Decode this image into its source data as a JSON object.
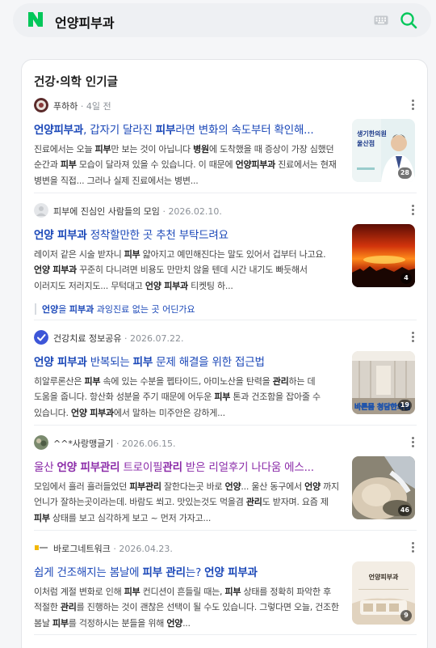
{
  "search": {
    "query": "언양피부과"
  },
  "section": {
    "title": "건강·의학 인기글"
  },
  "posts": [
    {
      "author": "푸하하",
      "date": "4일 전",
      "title_parts": [
        [
          "언양피부과",
          true
        ],
        [
          ", 갑자기 달라진 ",
          false
        ],
        [
          "피부",
          true
        ],
        [
          "라면 변화의 속도부터 확인해...",
          false
        ]
      ],
      "body_parts": [
        [
          "진료에서는 오늘 ",
          false
        ],
        [
          "피부",
          true
        ],
        [
          "만 보는 것이 아닙니다 ",
          false
        ],
        [
          "병원",
          true
        ],
        [
          "에 도착했을 때 증상이 가장 심했던 순간과 ",
          false
        ],
        [
          "피부",
          true
        ],
        [
          " 모습이 달라져 있을 수 있습니다. 이 때문에 ",
          false
        ],
        [
          "언양피부과",
          true
        ],
        [
          " 진료에서는 현재 병변을 직접... 그러나 실제 진료에서는 병변...",
          false
        ]
      ],
      "thumb_count": "28"
    },
    {
      "author": "피부에 진심인 사람들의 모임",
      "date": "2026.02.10.",
      "title_parts": [
        [
          "언양 피부과",
          true
        ],
        [
          " 정착할만한 곳 추천 부탁드려요",
          false
        ]
      ],
      "body_parts": [
        [
          "레이저 같은 시술 받자니 ",
          false
        ],
        [
          "피부",
          true
        ],
        [
          " 얇아지고 예민해진다는 말도 있어서 겁부터 나고요. ",
          false
        ],
        [
          "언양 피부과",
          true
        ],
        [
          " 꾸준히 다니려면 비용도 만만치 않을 텐데 시간 내기도 빠듯해서 이러지도 저러지도... 무턱대고 ",
          false
        ],
        [
          "언양 피부과",
          true
        ],
        [
          " 티켓팅 하...",
          false
        ]
      ],
      "thumb_count": "4",
      "related": [
        [
          "언양",
          true
        ],
        [
          "을 ",
          false
        ],
        [
          "피부과",
          true
        ],
        [
          " 과잉진료 없는 곳 어딘가요",
          false
        ]
      ]
    },
    {
      "author": "건강치료 정보공유",
      "date": "2026.07.22.",
      "title_parts": [
        [
          "언양 피부과",
          true
        ],
        [
          " 반복되는 ",
          false
        ],
        [
          "피부",
          true
        ],
        [
          " 문제 해결을 위한 접근법",
          false
        ]
      ],
      "body_parts": [
        [
          "히알루론산은 ",
          false
        ],
        [
          "피부",
          true
        ],
        [
          " 속에 있는 수분을 펩타이드, 아미노산을 탄력을 ",
          false
        ],
        [
          "관리",
          true
        ],
        [
          "하는 데 도움을 줍니다. 항산화 성분을 주기 때문에 어두운 ",
          false
        ],
        [
          "피부",
          true
        ],
        [
          " 톤과 건조함을 잡아줄 수 있습니다. ",
          false
        ],
        [
          "언양 피부과",
          true
        ],
        [
          "에서 말하는 미주안은 강하게...",
          false
        ]
      ],
      "thumb_count": "19"
    },
    {
      "author": "^^*사랑맹글기",
      "date": "2026.06.15.",
      "title_visited": true,
      "title_parts": [
        [
          "울산 ",
          false
        ],
        [
          "언양 피부관리",
          true
        ],
        [
          " 트로이필",
          false
        ],
        [
          "관리",
          true
        ],
        [
          " 받은 리얼후기 나다움 에스...",
          false
        ]
      ],
      "body_parts": [
        [
          "모임에서 흘러 흘러들었던 ",
          false
        ],
        [
          "피부관리",
          true
        ],
        [
          " 잘한다는곳 바로 ",
          false
        ],
        [
          "언양",
          true
        ],
        [
          "... 울산 동구에서 ",
          false
        ],
        [
          "언양",
          true
        ],
        [
          " 까지 언니가 잘하는곳이라는데. 바람도 쐬고. 맛있는것도 먹을겸 ",
          false
        ],
        [
          "관리",
          true
        ],
        [
          "도 받자며. 요즘 제 ",
          false
        ],
        [
          "피부",
          true
        ],
        [
          " 상태를 보고 심각하게 보고 ~ 먼저 가자고...",
          false
        ]
      ],
      "thumb_count": "46"
    },
    {
      "author": "바로그네트워크",
      "date": "2026.04.23.",
      "title_parts": [
        [
          "쉽게 건조해지는 봄날에 ",
          false
        ],
        [
          "피부 관리",
          true
        ],
        [
          "는? ",
          false
        ],
        [
          "언양 피부과",
          true
        ]
      ],
      "body_parts": [
        [
          "이처럼 계절 변화로 인해 ",
          false
        ],
        [
          "피부",
          true
        ],
        [
          " 컨디션이 흔들릴 때는, ",
          false
        ],
        [
          "피부",
          true
        ],
        [
          " 상태를 정확히 파악한 후 적절한 ",
          false
        ],
        [
          "관리",
          true
        ],
        [
          "를 진행하는 것이 괜찮은 선택이 될 수도 있습니다. 그렇다면 오늘, 건조한 봄날 ",
          false
        ],
        [
          "피부",
          true
        ],
        [
          "를 걱정하시는 분들을 위해 ",
          false
        ],
        [
          "언양",
          true
        ],
        [
          "...",
          false
        ]
      ],
      "thumb_count": "9"
    }
  ],
  "thumb_texts": {
    "post1": "생기한의원 울산점",
    "post3": "바른몸 청담한의원",
    "post5": "언양피부과"
  },
  "colors": {
    "link": "#1a47b8",
    "visited": "#8a2aa8",
    "naver_green": "#03c75a"
  }
}
